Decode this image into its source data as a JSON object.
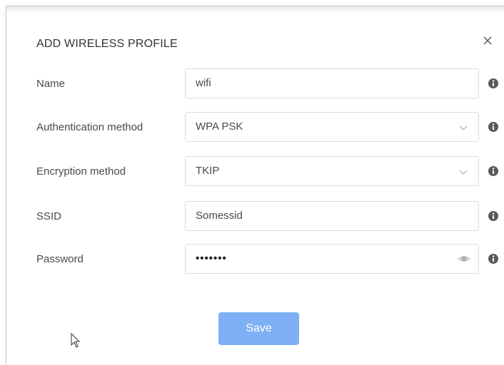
{
  "dialog": {
    "title": "ADD WIRELESS PROFILE",
    "close_icon": "close-icon"
  },
  "fields": {
    "name": {
      "label": "Name",
      "value": "wifi"
    },
    "auth": {
      "label": "Authentication method",
      "value": "WPA PSK"
    },
    "encryption": {
      "label": "Encryption method",
      "value": "TKIP"
    },
    "ssid": {
      "label": "SSID",
      "value": "Somessid"
    },
    "password": {
      "label": "Password",
      "value": "•••••••"
    }
  },
  "icons": {
    "info": "info-icon",
    "dropdown": "chevron-down-icon",
    "show_password": "eye-icon"
  },
  "actions": {
    "save_label": "Save"
  },
  "colors": {
    "primary_button": "#7fb0f5",
    "info_icon": "#5a5a5a"
  }
}
